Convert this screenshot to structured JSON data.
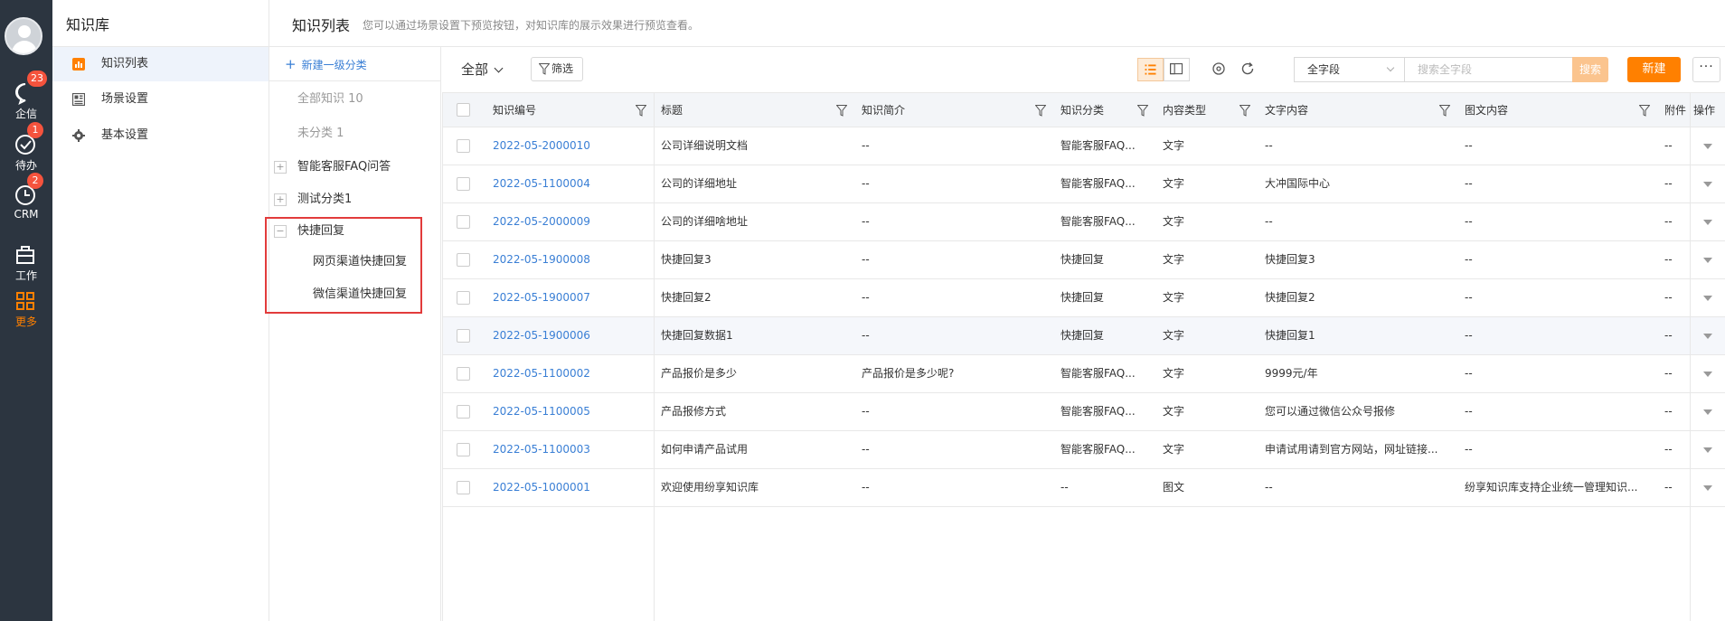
{
  "rail": {
    "items": [
      {
        "label": "企信",
        "badge": "23"
      },
      {
        "label": "待办",
        "badge": "1"
      },
      {
        "label": "CRM",
        "badge": "2"
      },
      {
        "label": "工作",
        "badge": ""
      },
      {
        "label": "更多",
        "badge": ""
      }
    ],
    "active_color": "#ff8000"
  },
  "nav": {
    "title": "知识库",
    "items": [
      {
        "label": "知识列表",
        "icon": "chart-icon"
      },
      {
        "label": "场景设置",
        "icon": "layout-icon"
      },
      {
        "label": "基本设置",
        "icon": "gear-icon"
      }
    ]
  },
  "header": {
    "title": "知识列表",
    "description": "您可以通过场景设置下预览按钮，对知识库的展示效果进行预览查看。"
  },
  "categories": {
    "add_label": "新建一级分类",
    "all_label": "全部知识 10",
    "uncat_label": "未分类 1",
    "groups": [
      {
        "label": "智能客服FAQ问答",
        "toggle": "+"
      },
      {
        "label": "测试分类1",
        "toggle": "+"
      },
      {
        "label": "快捷回复",
        "toggle": "−"
      }
    ],
    "children": [
      "网页渠道快捷回复",
      "微信渠道快捷回复"
    ]
  },
  "toolbar": {
    "scope": "全部",
    "filter": "筛选",
    "field_select": "全字段",
    "search_placeholder": "搜索全字段",
    "search_button": "搜索",
    "new_button": "新建",
    "more_button": "···"
  },
  "table": {
    "columns": [
      "知识编号",
      "标题",
      "知识简介",
      "知识分类",
      "内容类型",
      "文字内容",
      "图文内容",
      "附件",
      "操作"
    ],
    "rows": [
      [
        "2022-05-2000010",
        "公司详细说明文档",
        "--",
        "智能客服FAQ...",
        "文字",
        "--",
        "--",
        "--"
      ],
      [
        "2022-05-1100004",
        "公司的详细地址",
        "--",
        "智能客服FAQ...",
        "文字",
        "大冲国际中心",
        "--",
        "--"
      ],
      [
        "2022-05-2000009",
        "公司的详细啥地址",
        "--",
        "智能客服FAQ...",
        "文字",
        "--",
        "--",
        "--"
      ],
      [
        "2022-05-1900008",
        "快捷回复3",
        "--",
        "快捷回复",
        "文字",
        "快捷回复3",
        "--",
        "--"
      ],
      [
        "2022-05-1900007",
        "快捷回复2",
        "--",
        "快捷回复",
        "文字",
        "快捷回复2",
        "--",
        "--"
      ],
      [
        "2022-05-1900006",
        "快捷回复数据1",
        "--",
        "快捷回复",
        "文字",
        "快捷回复1",
        "--",
        "--"
      ],
      [
        "2022-05-1100002",
        "产品报价是多少",
        "产品报价是多少呢?",
        "智能客服FAQ...",
        "文字",
        "9999元/年",
        "--",
        "--"
      ],
      [
        "2022-05-1100005",
        "产品报修方式",
        "--",
        "智能客服FAQ...",
        "文字",
        "您可以通过微信公众号报修",
        "--",
        "--"
      ],
      [
        "2022-05-1100003",
        "如何申请产品试用",
        "--",
        "智能客服FAQ...",
        "文字",
        "申请试用请到官方网站，网址链接...",
        "--",
        "--"
      ],
      [
        "2022-05-1000001",
        "欢迎使用纷享知识库",
        "--",
        "--",
        "图文",
        "--",
        "纷享知识库支持企业统一管理知识...",
        "--"
      ]
    ],
    "link_color": "#3a7fd5"
  }
}
